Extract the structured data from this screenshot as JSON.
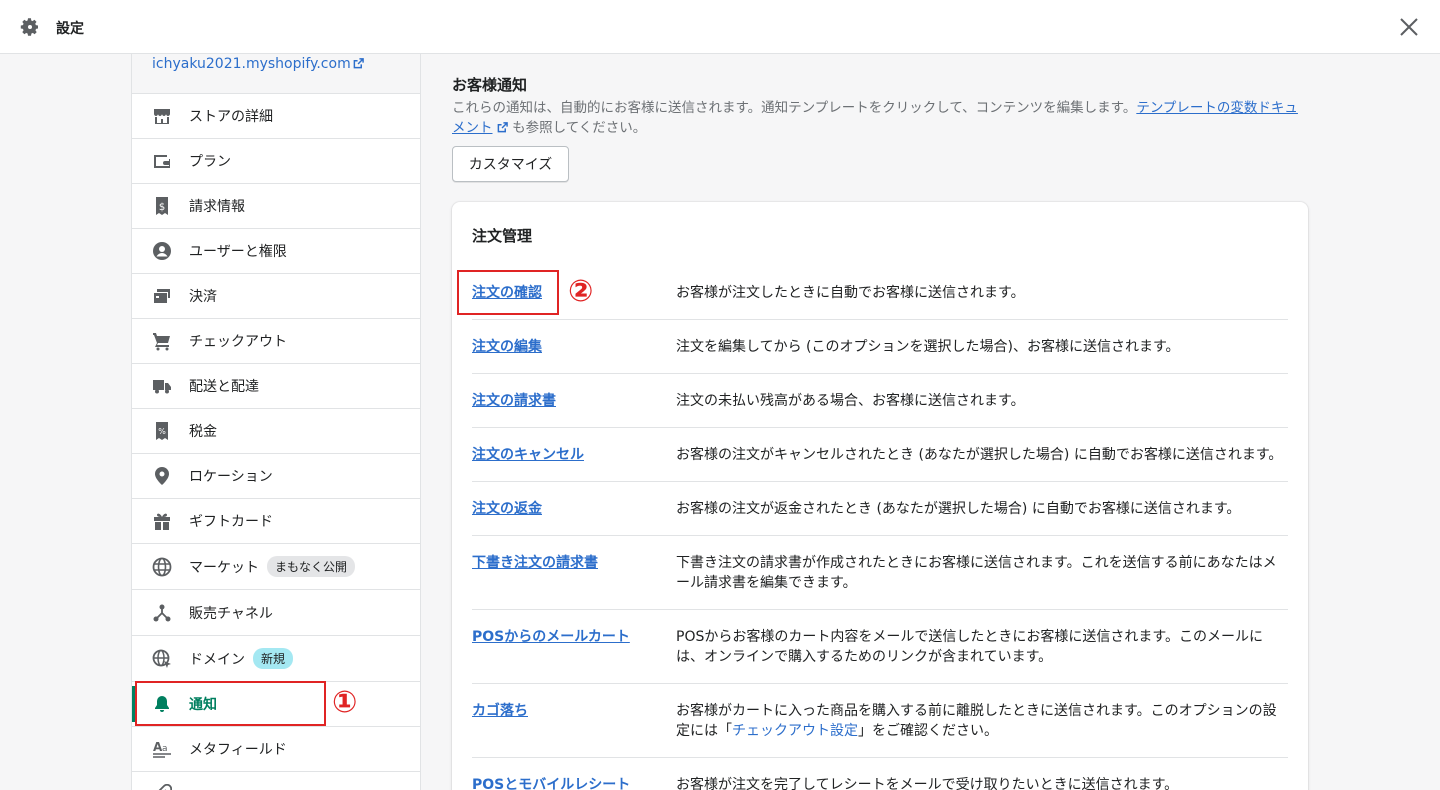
{
  "header": {
    "title": "設定"
  },
  "sidebar": {
    "store_link": "ichyaku2021.myshopify.com",
    "items": [
      {
        "label": "ストアの詳細",
        "icon": "store-icon"
      },
      {
        "label": "プラン",
        "icon": "wallet-icon"
      },
      {
        "label": "請求情報",
        "icon": "billing-icon"
      },
      {
        "label": "ユーザーと権限",
        "icon": "user-icon"
      },
      {
        "label": "決済",
        "icon": "payments-icon"
      },
      {
        "label": "チェックアウト",
        "icon": "cart-icon"
      },
      {
        "label": "配送と配達",
        "icon": "truck-icon"
      },
      {
        "label": "税金",
        "icon": "tax-icon"
      },
      {
        "label": "ロケーション",
        "icon": "location-icon"
      },
      {
        "label": "ギフトカード",
        "icon": "gift-icon"
      },
      {
        "label": "マーケット",
        "icon": "globe-icon",
        "badge": "まもなく公開"
      },
      {
        "label": "販売チャネル",
        "icon": "channels-icon"
      },
      {
        "label": "ドメイン",
        "icon": "domain-icon",
        "badge": "新規"
      },
      {
        "label": "通知",
        "icon": "bell-icon",
        "active": true
      },
      {
        "label": "メタフィールド",
        "icon": "metafields-icon"
      }
    ]
  },
  "annotations": {
    "one": "①",
    "two": "②"
  },
  "main": {
    "section_title": "お客様通知",
    "description": "これらの通知は、自動的にお客様に送信されます。通知テンプレートをクリックして、コンテンツを編集します。",
    "doc_link": "テンプレートの変数ドキュメント",
    "description_suffix": "も参照してください。",
    "customize_button": "カスタマイズ",
    "card_title": "注文管理",
    "rows": [
      {
        "name": "注文の確認",
        "desc": "お客様が注文したときに自動でお客様に送信されます。"
      },
      {
        "name": "注文の編集",
        "desc": "注文を編集してから (このオプションを選択した場合)、お客様に送信されます。"
      },
      {
        "name": "注文の請求書",
        "desc": "注文の未払い残高がある場合、お客様に送信されます。"
      },
      {
        "name": "注文のキャンセル",
        "desc": "お客様の注文がキャンセルされたとき (あなたが選択した場合) に自動でお客様に送信されます。"
      },
      {
        "name": "注文の返金",
        "desc": "お客様の注文が返金されたとき (あなたが選択した場合) に自動でお客様に送信されます。"
      },
      {
        "name": "下書き注文の請求書",
        "desc": "下書き注文の請求書が作成されたときにお客様に送信されます。これを送信する前にあなたはメール請求書を編集できます。"
      },
      {
        "name": "POSからのメールカート",
        "desc": "POSからお客様のカート内容をメールで送信したときにお客様に送信されます。このメールには、オンラインで購入するためのリンクが含まれています。"
      },
      {
        "name": "カゴ落ち",
        "desc_before": "お客様がカートに入った商品を購入する前に離脱したときに送信されます。このオプションの設定には「",
        "desc_link": "チェックアウト設定",
        "desc_after": "」をご確認ください。"
      },
      {
        "name": "POSとモバイルレシート",
        "desc": "お客様が注文を完了してレシートをメールで受け取りたいときに送信されます。"
      }
    ]
  }
}
